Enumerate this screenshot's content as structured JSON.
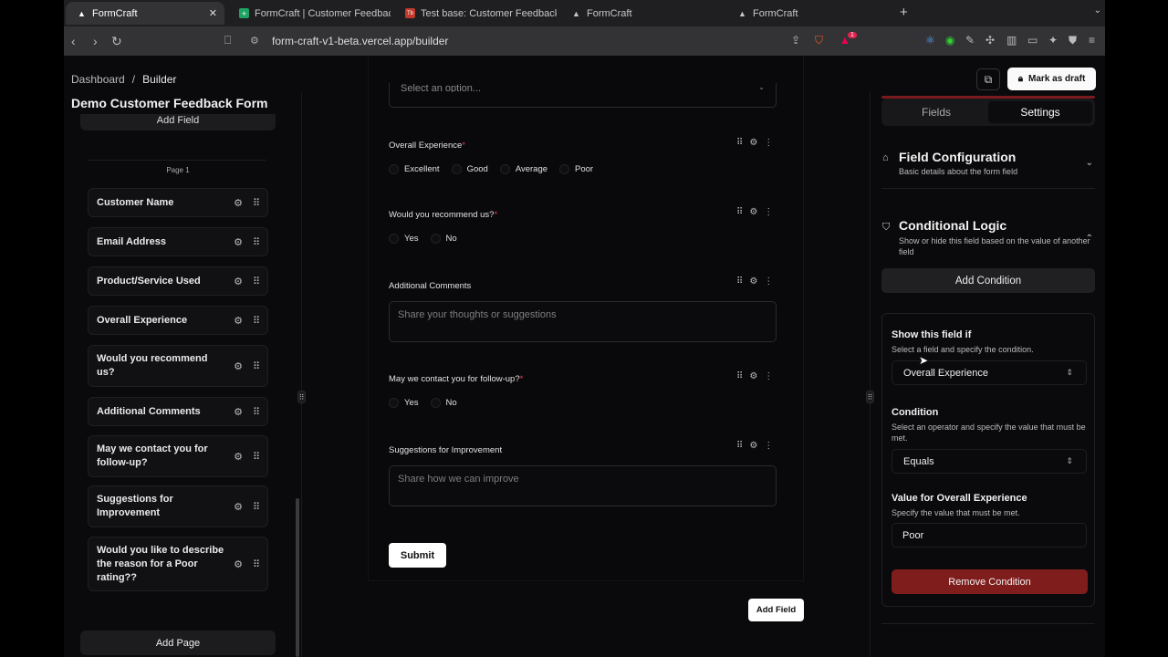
{
  "browser": {
    "tabs": [
      {
        "title": "FormCraft",
        "active": true,
        "icon": "triangle-logo-icon"
      },
      {
        "title": "FormCraft | Customer Feedback F",
        "active": false,
        "icon": "sheets-icon"
      },
      {
        "title": "Test base: Customer Feedback -",
        "active": false,
        "icon": "tb-icon"
      },
      {
        "title": "FormCraft",
        "active": false,
        "icon": "triangle-logo-icon"
      },
      {
        "title": "FormCraft",
        "active": false,
        "icon": "triangle-logo-icon"
      }
    ],
    "url": "form-craft-v1-beta.vercel.app/builder",
    "brave_badge": "1"
  },
  "header": {
    "breadcrumb": [
      "Dashboard",
      "/",
      "Builder"
    ],
    "mark_draft_label": "Mark as draft"
  },
  "form_title": "Demo Customer Feedback Form",
  "left_panel": {
    "add_field_label": "Add Field",
    "page_label": "Page 1",
    "fields": [
      "Customer Name",
      "Email Address",
      "Product/Service Used",
      "Overall Experience",
      "Would you recommend us?",
      "Additional Comments",
      "May we contact you for follow-up?",
      "Suggestions for Improvement",
      "Would you like to describe the reason for a Poor rating??"
    ],
    "add_page_label": "Add Page"
  },
  "canvas": {
    "select_placeholder": "Select an option...",
    "questions": [
      {
        "label": "Overall Experience",
        "required": "*",
        "options": [
          "Excellent",
          "Good",
          "Average",
          "Poor"
        ]
      },
      {
        "label": "Would you recommend us?",
        "required": "*",
        "options": [
          "Yes",
          "No"
        ]
      },
      {
        "label": "Additional Comments",
        "placeholder": "Share your thoughts or suggestions"
      },
      {
        "label": "May we contact you for follow-up?",
        "required": "*",
        "options": [
          "Yes",
          "No"
        ]
      },
      {
        "label": "Suggestions for Improvement",
        "placeholder": "Share how we can improve"
      }
    ],
    "submit_label": "Submit",
    "add_field_label": "Add Field"
  },
  "right_panel": {
    "tabs": [
      "Fields",
      "Settings"
    ],
    "field_config": {
      "title": "Field Configuration",
      "subtitle": "Basic details about the form field"
    },
    "conditional_logic": {
      "title": "Conditional Logic",
      "subtitle": "Show or hide this field based on the value of another field"
    },
    "add_condition_label": "Add Condition",
    "condition": {
      "show_if_label": "Show this field if",
      "show_if_sub": "Select a field and specify the condition.",
      "field_value": "Overall Experience",
      "condition_label": "Condition",
      "condition_sub": "Select an operator and specify the value that must be met.",
      "operator_value": "Equals",
      "value_label": "Value for Overall Experience",
      "value_sub": "Specify the value that must be met.",
      "value": "Poor",
      "remove_label": "Remove Condition"
    }
  },
  "colors": {
    "accent_red": "#7f1d1d",
    "required_star": "#e03c4a"
  }
}
